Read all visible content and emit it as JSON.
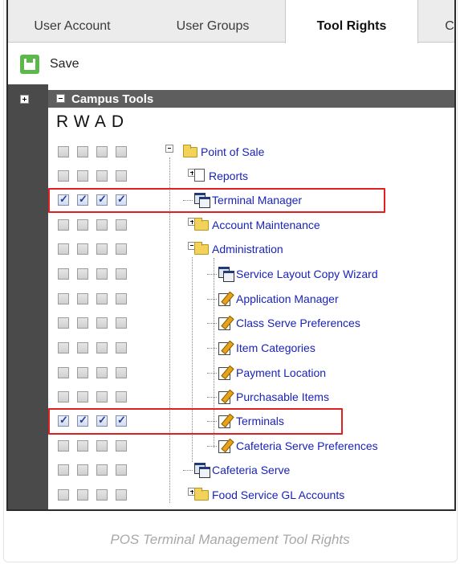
{
  "tabs": [
    {
      "label": "User Account",
      "active": false
    },
    {
      "label": "User Groups",
      "active": false
    },
    {
      "label": "Tool Rights",
      "active": true
    },
    {
      "label": "C",
      "active": false
    }
  ],
  "toolbar": {
    "save_label": "Save"
  },
  "tree": {
    "root_label": "Campus Tools",
    "rights_header": "RWAD",
    "items": [
      {
        "label": "Point of Sale",
        "icon": "folder-icon",
        "toggle": "minus",
        "checked": false
      },
      {
        "label": "Reports",
        "icon": "page-icon",
        "toggle": "plus",
        "checked": false
      },
      {
        "label": "Terminal Manager",
        "icon": "window-icon",
        "toggle": "",
        "checked": true
      },
      {
        "label": "Account Maintenance",
        "icon": "folder-icon",
        "toggle": "plus",
        "checked": false
      },
      {
        "label": "Administration",
        "icon": "folder-icon",
        "toggle": "minus",
        "checked": false
      },
      {
        "label": "Service Layout Copy Wizard",
        "icon": "window-icon",
        "toggle": "",
        "checked": false
      },
      {
        "label": "Application Manager",
        "icon": "edit-icon",
        "toggle": "",
        "checked": false
      },
      {
        "label": "Class Serve Preferences",
        "icon": "edit-icon",
        "toggle": "",
        "checked": false
      },
      {
        "label": "Item Categories",
        "icon": "edit-icon",
        "toggle": "",
        "checked": false
      },
      {
        "label": "Payment Location",
        "icon": "edit-icon",
        "toggle": "",
        "checked": false
      },
      {
        "label": "Purchasable Items",
        "icon": "edit-icon",
        "toggle": "",
        "checked": false
      },
      {
        "label": "Terminals",
        "icon": "edit-icon",
        "toggle": "",
        "checked": true
      },
      {
        "label": "Cafeteria Serve Preferences",
        "icon": "edit-icon",
        "toggle": "",
        "checked": false
      },
      {
        "label": "Cafeteria Serve",
        "icon": "window-icon",
        "toggle": "",
        "checked": false
      },
      {
        "label": "Food Service GL Accounts",
        "icon": "folder-icon",
        "toggle": "plus",
        "checked": false
      }
    ]
  },
  "caption": "POS Terminal Management Tool Rights",
  "colors": {
    "highlight": "#e02020",
    "link": "#1a23b8",
    "save": "#5cb84a"
  }
}
